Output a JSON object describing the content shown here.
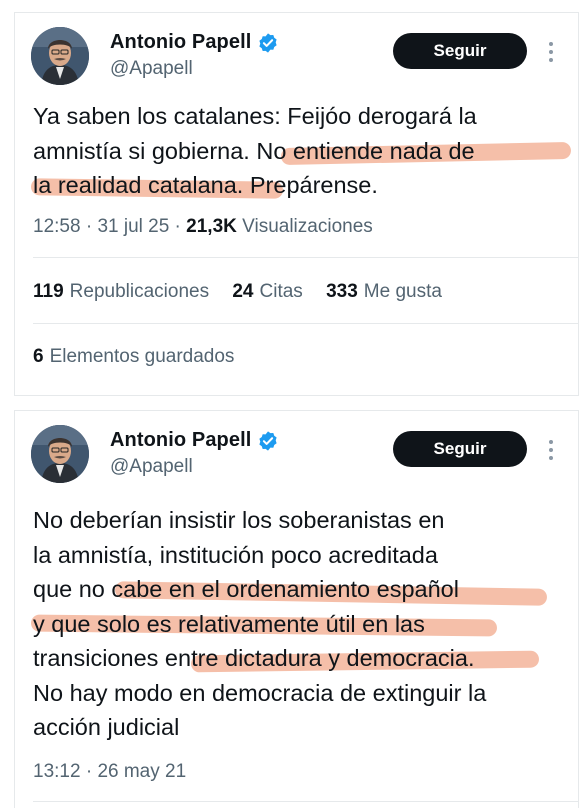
{
  "tweets": [
    {
      "author_name": "Antonio Papell",
      "author_handle": "@Apapell",
      "follow_label": "Seguir",
      "text_lines": [
        "Ya saben los catalanes: Feijóo derogará la",
        "amnistía si gobierna. No entiende nada de",
        "la realidad catalana. Prepárense."
      ],
      "time": "12:58",
      "date": "31 jul 25",
      "views_count": "21,3K",
      "views_label": "Visualizaciones",
      "retweets_count": "119",
      "retweets_label": "Republicaciones",
      "quotes_count": "24",
      "quotes_label": "Citas",
      "likes_count": "333",
      "likes_label": "Me gusta",
      "bookmarks_count": "6",
      "bookmarks_label": "Elementos guardados"
    },
    {
      "author_name": "Antonio Papell",
      "author_handle": "@Apapell",
      "follow_label": "Seguir",
      "text_lines": [
        "No deberían insistir los soberanistas en",
        "la amnistía, institución poco acreditada",
        "que no cabe en el ordenamiento español",
        "y que solo es relativamente útil en las",
        "transiciones entre dictadura y democracia.",
        "No hay modo en democracia de extinguir la",
        "acción judicial"
      ],
      "time": "13:12",
      "date": "26 may 21"
    }
  ],
  "colors": {
    "verified_badge": "#1d9bf0",
    "follow_button": "#0f1419",
    "secondary_text": "#536471",
    "highlight_marker": "#f2a98c"
  },
  "icons": [
    "verified-badge-icon",
    "more-options-icon"
  ]
}
